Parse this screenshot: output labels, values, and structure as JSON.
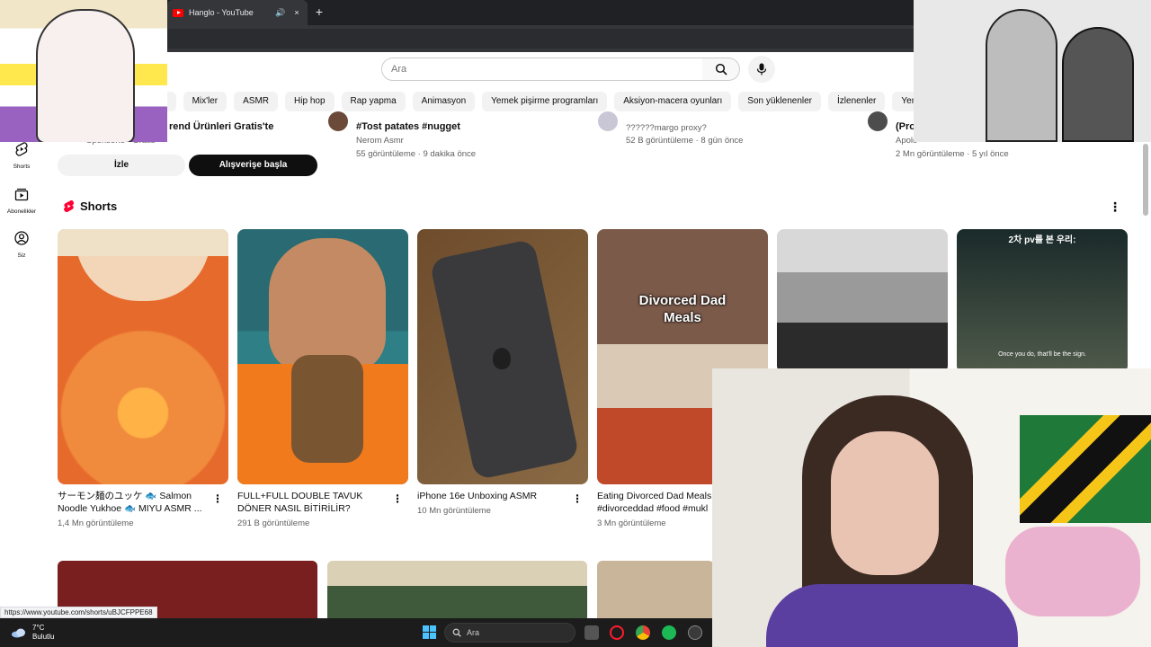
{
  "browser": {
    "tab_title": "Hanglo - YouTube",
    "tab_audio_icon": "speaker-icon",
    "tab_close": "×",
    "new_tab": "+"
  },
  "masthead": {
    "search_placeholder": "Ara"
  },
  "chips": [
    "n",
    "Mix'ler",
    "ASMR",
    "Hip hop",
    "Rap yapma",
    "Animasyon",
    "Yemek pişirme programları",
    "Aksiyon-macera oyunları",
    "Son yüklenenler",
    "İzlenenler",
    "Yeni öneriler"
  ],
  "guide": [
    {
      "label": "Shorts",
      "icon": "shorts-icon"
    },
    {
      "label": "Abonelikler",
      "icon": "subscriptions-icon"
    },
    {
      "label": "Siz",
      "icon": "you-icon"
    }
  ],
  "top_row": {
    "ad": {
      "title": "rend Ürünleri Gratis'te",
      "sponsor": "Sponsorlu · Gratis",
      "watch_button": "İzle",
      "shop_button": "Alışverişe başla"
    },
    "video1": {
      "title": "#Tost patates #nugget",
      "channel": "Nerom Asmr",
      "meta": "55 görüntüleme · 9 dakika önce"
    },
    "video2": {
      "title": "??????margo proxy?",
      "meta": "52 B görüntüleme · 8 gün önce"
    },
    "video3": {
      "title": "(Pro",
      "channel": "Apolo",
      "meta": "2 Mn görüntüleme · 5 yıl önce"
    }
  },
  "shorts": {
    "heading": "Shorts",
    "items": [
      {
        "title": "サーモン麺のユッケ 🐟 Salmon Noodle Yukhoe 🐟 MIYU ASMR ...",
        "views": "1,4 Mn görüntüleme"
      },
      {
        "title": "FULL+FULL DOUBLE TAVUK DÖNER NASIL BİTİRİLİR?",
        "views": "291 B görüntüleme"
      },
      {
        "title": "iPhone 16e Unboxing ASMR",
        "views": "10 Mn görüntüleme"
      },
      {
        "title": "Eating Divorced Dad Meals #divorceddad #food #mukl",
        "views": "3 Mn görüntüleme",
        "overlay": "Divorced Dad Meals"
      },
      {
        "title": "",
        "views": ""
      },
      {
        "title": "",
        "views": "",
        "overlay_top": "2차 pv를 본 우리:",
        "subtitle": "Once you do, that'll be the sign."
      }
    ]
  },
  "status_url": "https://www.youtube.com/shorts/uBJCFPPE68",
  "taskbar": {
    "temperature": "7°C",
    "condition": "Bulutlu",
    "search_placeholder": "Ara"
  },
  "colors": {
    "accent_red": "#ff0000",
    "chip_bg": "#f2f2f2",
    "taskbar_bg": "#1c1c1c"
  }
}
